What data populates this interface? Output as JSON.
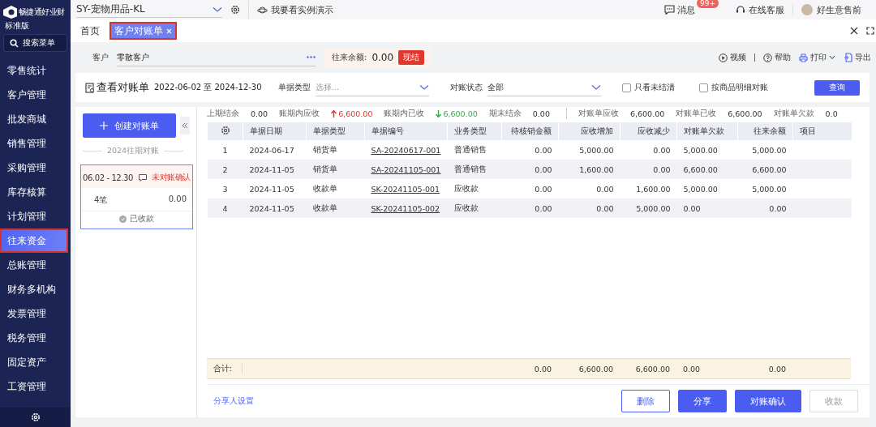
{
  "sidebar": {
    "brand": "畅捷通好业财",
    "edition": "标准版",
    "search": "搜索菜单",
    "items": [
      {
        "label": "零售统计",
        "selected": false,
        "highlighted": false
      },
      {
        "label": "客户管理",
        "selected": false,
        "highlighted": false
      },
      {
        "label": "批发商城",
        "selected": false,
        "highlighted": false
      },
      {
        "label": "销售管理",
        "selected": false,
        "highlighted": false
      },
      {
        "label": "采购管理",
        "selected": false,
        "highlighted": false
      },
      {
        "label": "库存核算",
        "selected": false,
        "highlighted": false
      },
      {
        "label": "计划管理",
        "selected": false,
        "highlighted": false
      },
      {
        "label": "往来资金",
        "selected": true,
        "highlighted": true
      },
      {
        "label": "总账管理",
        "selected": false,
        "highlighted": false
      },
      {
        "label": "财务多机构",
        "selected": false,
        "highlighted": false
      },
      {
        "label": "发票管理",
        "selected": false,
        "highlighted": false
      },
      {
        "label": "税务管理",
        "selected": false,
        "highlighted": false
      },
      {
        "label": "固定资产",
        "selected": false,
        "highlighted": false
      },
      {
        "label": "工资管理",
        "selected": false,
        "highlighted": false
      }
    ]
  },
  "topbar": {
    "company": "SY-宠物用品-KL",
    "demo": "我要看实例演示",
    "messages": {
      "label": "消息",
      "badge": "99+"
    },
    "service": "在线客服",
    "user": "好生意售前"
  },
  "tabs": [
    {
      "label": "首页",
      "selected": false,
      "highlighted": false,
      "closable": false
    },
    {
      "label": "客户对账单",
      "selected": true,
      "highlighted": true,
      "closable": true
    }
  ],
  "customer": {
    "label": "客户",
    "value": "零散客户",
    "balance_label": "往来余额:",
    "balance": "0.00",
    "tag": "现结"
  },
  "tools": [
    {
      "label": "视频",
      "kind": "video"
    },
    {
      "label": "帮助",
      "kind": "help"
    },
    {
      "label": "打印",
      "kind": "print"
    },
    {
      "label": "导出",
      "kind": "export"
    }
  ],
  "filters": {
    "title": "查看对账单",
    "date_range": "2022-06-02 至 2024-12-30",
    "doc_type": {
      "label": "单据类型",
      "placeholder": "选择..."
    },
    "status": {
      "label": "对账状态",
      "value": "全部"
    },
    "checkboxes": [
      {
        "label": "只看未结清",
        "checked": false
      },
      {
        "label": "按商品明细对账",
        "checked": false
      }
    ],
    "query_button": "查询"
  },
  "statements_pane": {
    "create_button": "创建对账单",
    "period_divider": "2024往期对账",
    "statements": [
      {
        "range": "06.02 - 12.30",
        "status": "未对账确认",
        "count": "4笔",
        "amount": "0.00",
        "receipt": "已收款",
        "selected": true
      }
    ]
  },
  "summary": [
    {
      "label": "上期结余",
      "value": "0.00",
      "kind": "plain"
    },
    {
      "label": "账期内应收",
      "value": "6,600.00",
      "kind": "up"
    },
    {
      "label": "账期内已收",
      "value": "6,600.00",
      "kind": "down"
    },
    {
      "label": "期末结余",
      "value": "0.00",
      "kind": "plain"
    },
    {
      "label": "对账单应收",
      "value": "6,600.00",
      "kind": "plain"
    },
    {
      "label": "对账单已收",
      "value": "6,600.00",
      "kind": "plain"
    },
    {
      "label": "对账单欠款",
      "value": "0.0",
      "kind": "plain"
    }
  ],
  "table": {
    "columns": [
      {
        "kind": "settings"
      },
      {
        "label": "单据日期",
        "kind": "text"
      },
      {
        "label": "单据类型",
        "kind": "text"
      },
      {
        "label": "单据编号",
        "kind": "link"
      },
      {
        "label": "业务类型",
        "kind": "text"
      },
      {
        "label": "待核销金额",
        "kind": "amount"
      },
      {
        "label": "应收增加",
        "kind": "amount"
      },
      {
        "label": "应收减少",
        "kind": "amount"
      },
      {
        "label": "对账单欠款",
        "kind": "text"
      },
      {
        "label": "往来余额",
        "kind": "amount"
      },
      {
        "label": "项目",
        "kind": "text"
      }
    ],
    "rows": [
      [
        "1",
        "2024-06-17",
        "销货单",
        "SA-20240617-001",
        "普通销售",
        "0.00",
        "5,000.00",
        "0.00",
        "5,000.00",
        "5,000.00"
      ],
      [
        "2",
        "2024-11-05",
        "销货单",
        "SA-20241105-001",
        "普通销售",
        "0.00",
        "1,600.00",
        "0.00",
        "6,600.00",
        "6,600.00"
      ],
      [
        "3",
        "2024-11-05",
        "收款单",
        "SK-20241105-001",
        "应收款",
        "0.00",
        "0.00",
        "1,600.00",
        "5,000.00",
        "5,000.00"
      ],
      [
        "4",
        "2024-11-05",
        "收款单",
        "SK-20241105-002",
        "应收款",
        "0.00",
        "0.00",
        "5,000.00",
        "0.00",
        "0.00"
      ]
    ],
    "totals": {
      "label": "合计:",
      "values": [
        "0.00",
        "6,600.00",
        "6,600.00",
        "0.00",
        "0.00"
      ]
    }
  },
  "footer": {
    "share_settings": "分享人设置",
    "buttons": [
      {
        "label": "删除",
        "kind": "outline"
      },
      {
        "label": "分享",
        "kind": "primary"
      },
      {
        "label": "对账确认",
        "kind": "primary"
      },
      {
        "label": "收款",
        "kind": "disabled"
      }
    ]
  }
}
